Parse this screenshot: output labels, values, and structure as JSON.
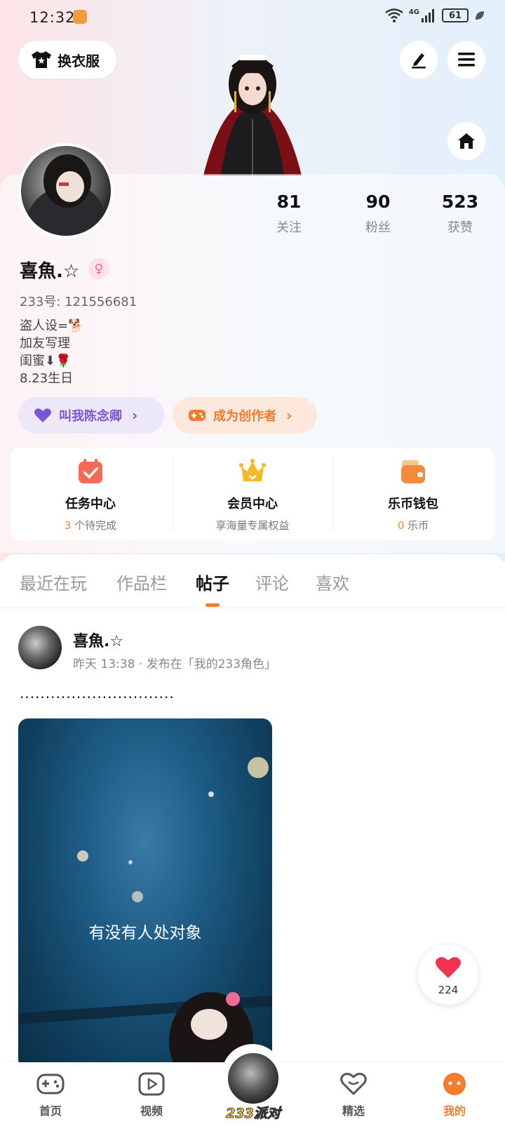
{
  "status_bar": {
    "time": "12:32",
    "battery": "61",
    "network": "4G"
  },
  "header": {
    "outfit_label": "换衣服"
  },
  "profile": {
    "stats": [
      {
        "value": "81",
        "label": "关注"
      },
      {
        "value": "90",
        "label": "粉丝"
      },
      {
        "value": "523",
        "label": "获赞"
      }
    ],
    "name": "喜魚.☆",
    "gender_symbol": "♀",
    "uid": "233号: 121556681",
    "bio_lines": [
      "盗人设=🐕",
      "加友写理",
      "闺蜜⬇🌹",
      "8.23生日"
    ],
    "pill_nickname": "叫我陈念卿",
    "pill_creator": "成为创作者"
  },
  "shortcuts": [
    {
      "title": "任务中心",
      "count": "3",
      "sub": "个待完成"
    },
    {
      "title": "会员中心",
      "sub": "享海量专属权益"
    },
    {
      "title": "乐币钱包",
      "count": "0",
      "sub": "乐币"
    }
  ],
  "tabs": [
    "最近在玩",
    "作品栏",
    "帖子",
    "评论",
    "喜欢"
  ],
  "active_tab": "帖子",
  "post": {
    "author": "喜魚.☆",
    "meta": "昨天 13:38 · 发布在「我的233角色」",
    "text": "..............................",
    "image_caption": "有没有人处对象",
    "like_count": "224"
  },
  "bottom_nav": [
    {
      "label": "首页"
    },
    {
      "label": "视频"
    },
    {
      "label": "233派对"
    },
    {
      "label": "精选"
    },
    {
      "label": "我的"
    }
  ],
  "colors": {
    "accent": "#f47c2c",
    "purple": "#7a55d6",
    "like": "#f0334f"
  }
}
